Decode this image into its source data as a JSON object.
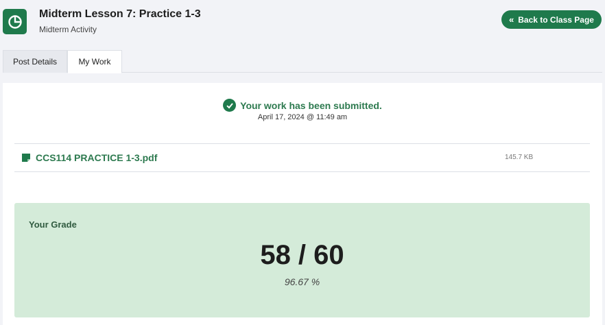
{
  "header": {
    "title": "Midterm Lesson 7: Practice 1-3",
    "subtitle": "Midterm Activity",
    "back_button_label": "Back to Class Page",
    "app_icon": "pie-chart-icon",
    "back_icon": "double-chevron-left-icon"
  },
  "tabs": [
    {
      "label": "Post Details",
      "active": false
    },
    {
      "label": "My Work",
      "active": true
    }
  ],
  "submission": {
    "status": "Your work has been submitted.",
    "date": "April 17, 2024 @ 11:49 am",
    "status_icon": "check-circle-icon"
  },
  "file": {
    "name": "CCS114 PRACTICE 1-3.pdf",
    "size": "145.7 KB",
    "icon": "file-icon"
  },
  "grade": {
    "label": "Your Grade",
    "score": "58 / 60",
    "percent": "96.67 %"
  },
  "colors": {
    "accent": "#1f7a4c",
    "accent_text": "#2d7a4f",
    "grade_bg": "#d4ebd9",
    "page_bg": "#f2f3f7"
  }
}
